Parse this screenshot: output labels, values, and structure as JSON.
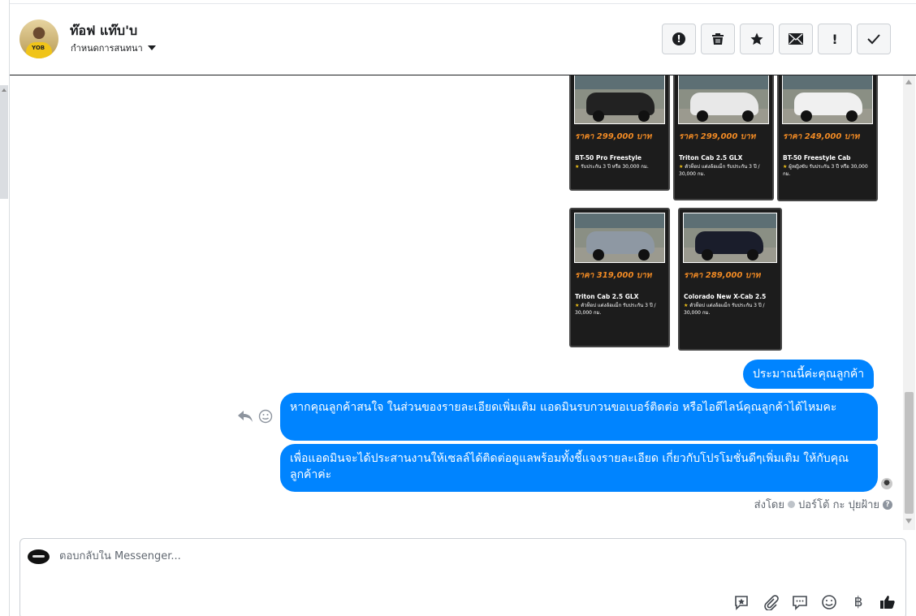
{
  "header": {
    "user_name": "ท๊อฟ แท๊บ'บ",
    "assign_label": "กำหนดการสนทนา",
    "actions": [
      {
        "name": "report-spam-button",
        "icon": "alert-circle-icon"
      },
      {
        "name": "delete-button",
        "icon": "trash-icon"
      },
      {
        "name": "star-button",
        "icon": "star-icon"
      },
      {
        "name": "mark-unread-button",
        "icon": "envelope-icon"
      },
      {
        "name": "mark-important-button",
        "icon": "exclamation-icon"
      },
      {
        "name": "mark-done-button",
        "icon": "check-icon"
      }
    ]
  },
  "cards": [
    {
      "price": "ราคา 299,000 บาท",
      "model": "BT-50 Pro Freestyle",
      "desc": "รับประกัน 3 ปี หรือ 30,000 กม.",
      "car_color": "#222"
    },
    {
      "price": "ราคา 299,000 บาท",
      "model": "Triton Cab 2.5 GLX",
      "desc": "ตัวท็อป แต่งล้อแม็ก รับประกัน 3 ปี / 30,000 กม.",
      "car_color": "#e8e8e8"
    },
    {
      "price": "ราคา 249,000 บาท",
      "model": "BT-50 Freestyle Cab",
      "desc": "ผู้หญิงขับ รับประกัน 3 ปี หรือ 30,000 กม.",
      "car_color": "#f0f0f0"
    },
    {
      "price": "ราคา 319,000 บาท",
      "model": "Triton Cab 2.5 GLX",
      "desc": "ตัวท็อป แต่งล้อแม็ก รับประกัน 3 ปี / 30,000 กม.",
      "car_color": "#8e98a3"
    },
    {
      "price": "ราคา 289,000 บาท",
      "model": "Colorado New X-Cab 2.5",
      "desc": "ตัวท็อป แต่งล้อแม็ก รับประกัน 3 ปี / 30,000 กม.",
      "car_color": "#1a1d2b"
    }
  ],
  "messages": [
    {
      "text": "ประมาณนี้ค่ะคุณลูกค้า"
    },
    {
      "text": "หากคุณลูกค้าสนใจ ในส่วนของรายละเอียดเพิ่มเติม แอดมินรบกวนขอเบอร์ติดต่อ หรือไอดีไลน์คุณลูกค้าได้ไหมคะ"
    },
    {
      "text": "เพื่อแอดมินจะได้ประสานงานให้เซลล์ได้ติดต่อดูแลพร้อมทั้งชี้แจงรายละเอียด เกี่ยวกับโปรโมชั่นดีๆเพิ่มเติม ให้กับคุณลูกค้าค่ะ"
    }
  ],
  "sent_by": {
    "prefix": "ส่งโดย",
    "name": "ปอร์โต้ กะ ปุยฝ้าย"
  },
  "composer": {
    "placeholder": "ตอบกลับใน Messenger...",
    "tools": [
      "saved-reply-icon",
      "attachment-icon",
      "chat-bubble-icon",
      "emoji-icon",
      "baht-icon",
      "thumbs-up-icon"
    ]
  }
}
